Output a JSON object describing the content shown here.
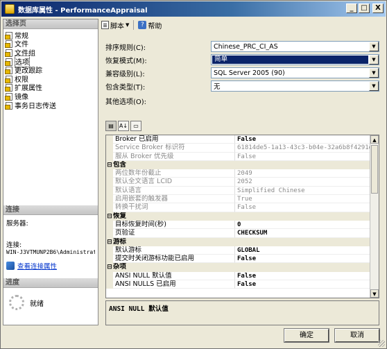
{
  "window": {
    "title": "数据库属性 - PerformanceAppraisal",
    "min_symbol": "_",
    "max_symbol": "□",
    "close_symbol": "X"
  },
  "left": {
    "select_page_header": "选择页",
    "pages": [
      "常规",
      "文件",
      "文件组",
      "选项",
      "更改跟踪",
      "权限",
      "扩展属性",
      "镜像",
      "事务日志传送"
    ],
    "selected_index": 3,
    "connection_header": "连接",
    "server_label": "服务器:",
    "connection_label": "连接:",
    "connection_value": "WIN-J3VTMUNP2B6\\Administrat",
    "view_conn_link": "查看连接属性",
    "progress_header": "进度",
    "progress_status": "就绪"
  },
  "toolbar": {
    "script_label": "脚本",
    "script_arrow": "▼",
    "help_label": "帮助"
  },
  "form": {
    "collation_label": "排序规则(C):",
    "collation_value": "Chinese_PRC_CI_AS",
    "recovery_label": "恢复模式(M):",
    "recovery_value": "简单",
    "compat_label": "兼容级别(L):",
    "compat_value": "SQL Server 2005 (90)",
    "containment_label": "包含类型(T):",
    "containment_value": "无",
    "other_label": "其他选项(O):",
    "dropdown_arrow": "▼"
  },
  "grid_toolbar": {
    "categorized_icon": "▤",
    "alpha_icon": "A↓",
    "pages_icon": "▭"
  },
  "properties": [
    {
      "name": "Broker 已启用",
      "value": "False",
      "type": "row",
      "bold": true,
      "readonly": false
    },
    {
      "name": "Service Broker 标识符",
      "value": "61814de5-1a13-43c3-b04e-32a6b8f4291d",
      "type": "row",
      "bold": false,
      "readonly": true
    },
    {
      "name": "服从 Broker 优先级",
      "value": "False",
      "type": "row",
      "bold": false,
      "readonly": true
    },
    {
      "name": "包含",
      "type": "category",
      "toggle": "⊟"
    },
    {
      "name": "两位数年份截止",
      "value": "2049",
      "type": "row",
      "bold": false,
      "readonly": true
    },
    {
      "name": "默认全文语言 LCID",
      "value": "2052",
      "type": "row",
      "bold": false,
      "readonly": true
    },
    {
      "name": "默认语言",
      "value": "Simplified Chinese",
      "type": "row",
      "bold": false,
      "readonly": true
    },
    {
      "name": "启用嵌套的触发器",
      "value": "True",
      "type": "row",
      "bold": false,
      "readonly": true
    },
    {
      "name": "转换干扰词",
      "value": "False",
      "type": "row",
      "bold": false,
      "readonly": true
    },
    {
      "name": "恢复",
      "type": "category",
      "toggle": "⊟"
    },
    {
      "name": "目标恢复时间(秒)",
      "value": "0",
      "type": "row",
      "bold": true,
      "readonly": false
    },
    {
      "name": "页验证",
      "value": "CHECKSUM",
      "type": "row",
      "bold": true,
      "readonly": false
    },
    {
      "name": "游标",
      "type": "category",
      "toggle": "⊟"
    },
    {
      "name": "默认游标",
      "value": "GLOBAL",
      "type": "row",
      "bold": true,
      "readonly": false
    },
    {
      "name": "提交时关闭游标功能已启用",
      "value": "False",
      "type": "row",
      "bold": true,
      "readonly": false
    },
    {
      "name": "杂项",
      "type": "category",
      "toggle": "⊟"
    },
    {
      "name": "ANSI NULL 默认值",
      "value": "False",
      "type": "row",
      "bold": true,
      "readonly": false
    },
    {
      "name": "ANSI NULLS 已启用",
      "value": "False",
      "type": "row",
      "bold": true,
      "readonly": false
    }
  ],
  "scroll": {
    "up": "▲",
    "down": "▼"
  },
  "description": "ANSI NULL 默认值",
  "buttons": {
    "ok": "确定",
    "cancel": "取消"
  }
}
